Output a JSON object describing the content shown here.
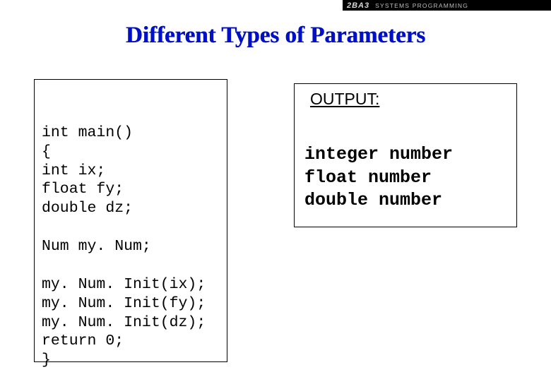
{
  "header": {
    "logo": "2BA3",
    "course": "SYSTEMS PROGRAMMING"
  },
  "title": "Different Types of Parameters",
  "code": "int main()\n{\nint ix;\nfloat fy;\ndouble dz;\n\nNum my. Num;\n\nmy. Num. Init(ix);\nmy. Num. Init(fy);\nmy. Num. Init(dz);\nreturn 0;\n}",
  "output": {
    "label": "OUTPUT:",
    "lines": "integer number\nfloat number\ndouble number"
  }
}
